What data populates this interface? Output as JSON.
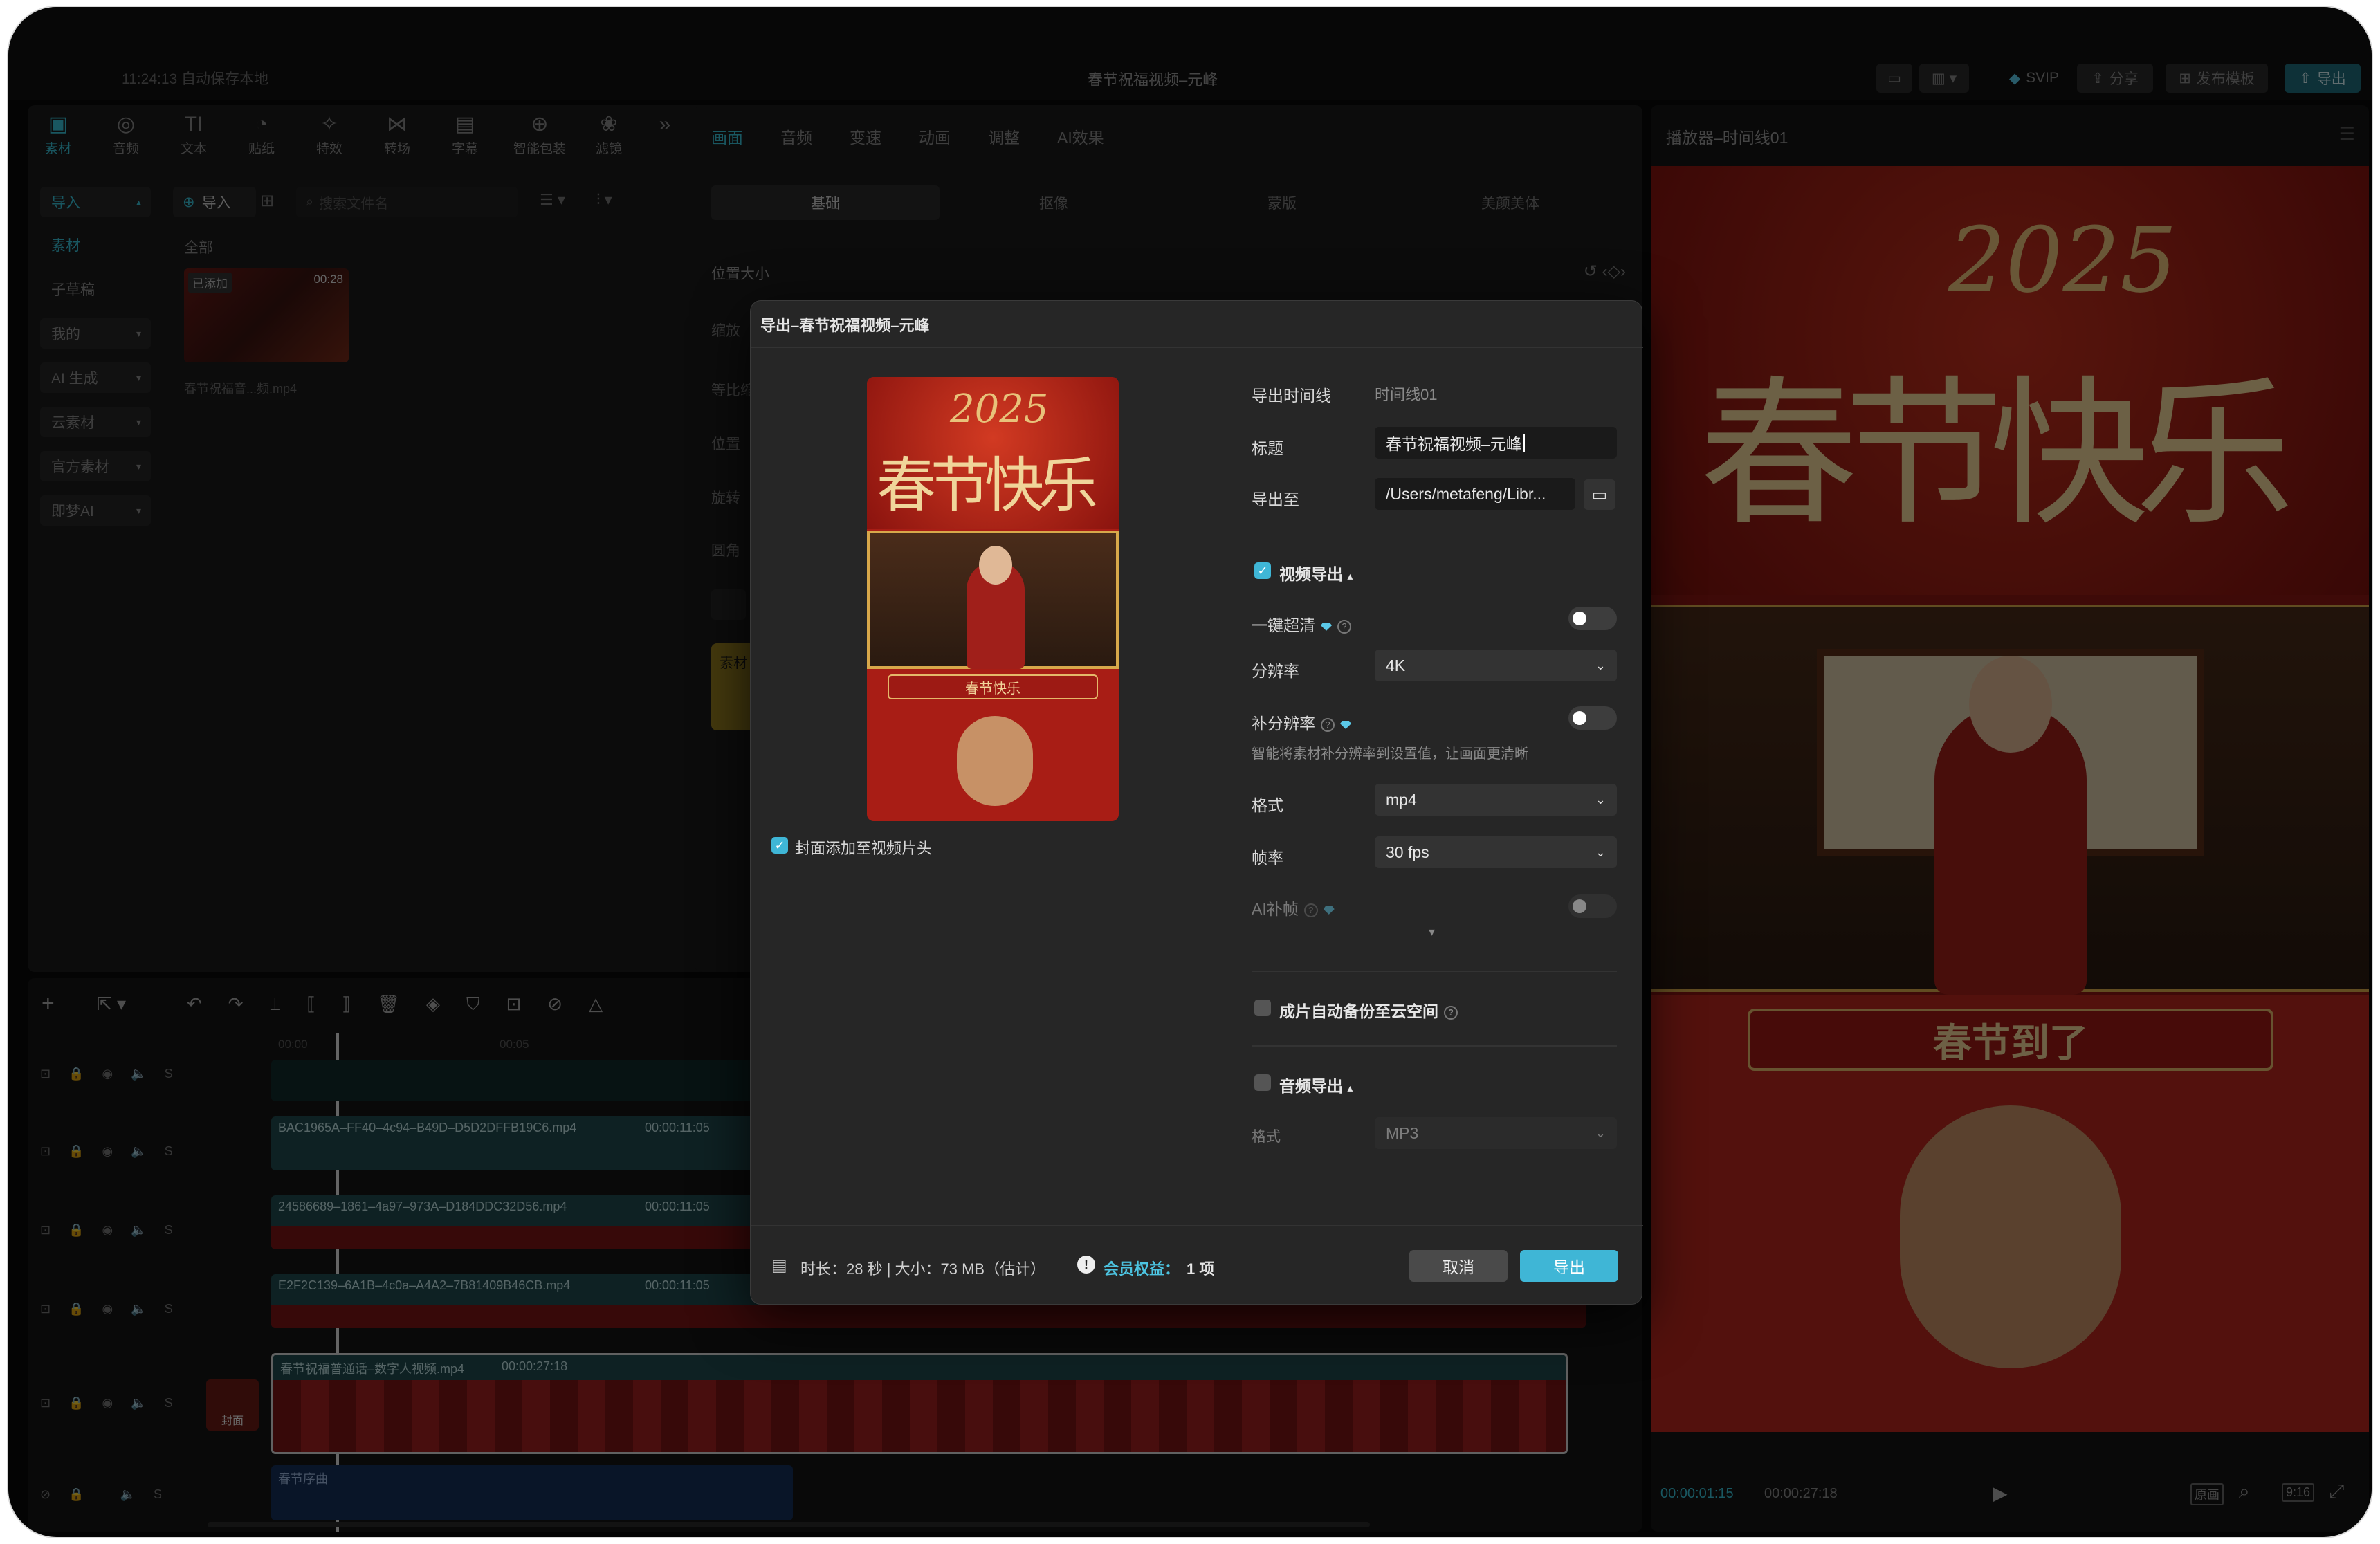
{
  "topbar": {
    "autosave": "11:24:13 自动保存本地",
    "title": "春节祝福视频–元峰",
    "svip": "SVIP",
    "share": "分享",
    "publish_template": "发布模板",
    "export": "导出"
  },
  "toolbar": {
    "items": [
      "素材",
      "音频",
      "文本",
      "贴纸",
      "特效",
      "转场",
      "字幕",
      "智能包装",
      "滤镜"
    ]
  },
  "media": {
    "import_label": "导入",
    "search_placeholder": "搜索文件名",
    "all_label": "全部",
    "added_badge": "已添加",
    "thumb_duration": "00:28",
    "thumb_name": "春节祝福音...频.mp4",
    "sidebar": [
      "导入",
      "素材",
      "子草稿",
      "我的",
      "AI 生成",
      "云素材",
      "官方素材",
      "即梦AI"
    ]
  },
  "props": {
    "tabs": [
      "画面",
      "音频",
      "变速",
      "动画",
      "调整",
      "AI效果"
    ],
    "subtabs": [
      "基础",
      "抠像",
      "蒙版",
      "美颜美体"
    ],
    "section": "位置大小",
    "rows": [
      "缩放",
      "等比缩",
      "位置",
      "旋转",
      "圆角"
    ],
    "assets_label": "素材"
  },
  "player": {
    "title": "播放器–时间线01",
    "time_current": "00:00:01:15",
    "time_total": "00:00:27:18",
    "poster_line": "2025",
    "poster_title": "春节快乐",
    "banner_text": "春节到了",
    "btn_original": "原画",
    "btn_ratio": "9:16"
  },
  "timeline": {
    "ruler": [
      "00:00",
      "00:05"
    ],
    "clips": [
      {
        "name": "BAC1965A–FF40–4c94–B49D–D5D2DFFB19C6.mp4",
        "duration": "00:00:11:05"
      },
      {
        "name": "24586689–1861–4a97–973A–D184DDC32D56.mp4",
        "duration": "00:00:11:05"
      },
      {
        "name": "E2F2C139–6A1B–4c0a–A4A2–7B81409B46CB.mp4",
        "duration": "00:00:11:05"
      },
      {
        "name": "春节祝福普通话–数字人视频.mp4",
        "duration": "00:00:27:18"
      }
    ],
    "cover_label": "封面",
    "audio_label": "春节序曲"
  },
  "dialog": {
    "title": "导出–春节祝福视频–元峰",
    "preview_year": "2025",
    "preview_title": "春节快乐",
    "preview_banner": "春节快乐",
    "cover_checkbox": "封面添加至视频片头",
    "timeline_label": "导出时间线",
    "timeline_value": "时间线01",
    "title_label": "标题",
    "title_value": "春节祝福视频–元峰",
    "export_to_label": "导出至",
    "export_to_value": "/Users/metafeng/Libr...",
    "video_export_label": "视频导出",
    "super_res_label": "一键超清",
    "resolution_label": "分辨率",
    "resolution_value": "4K",
    "frame_interp_label": "补分辨率",
    "frame_interp_hint": "智能将素材补分辨率到设置值，让画面更清晰",
    "format_label": "格式",
    "format_value": "mp4",
    "fps_label": "帧率",
    "fps_value": "30 fps",
    "ai_label": "AI补帧",
    "backup_label": "成片自动备份至云空间",
    "audio_export_label": "音频导出",
    "audio_format_label": "格式",
    "audio_format_value": "MP3",
    "footer_info": "时长：28 秒 | 大小：73 MB（估计）",
    "member_label": "会员权益：",
    "member_value": "1 项",
    "cancel": "取消",
    "confirm": "导出"
  }
}
